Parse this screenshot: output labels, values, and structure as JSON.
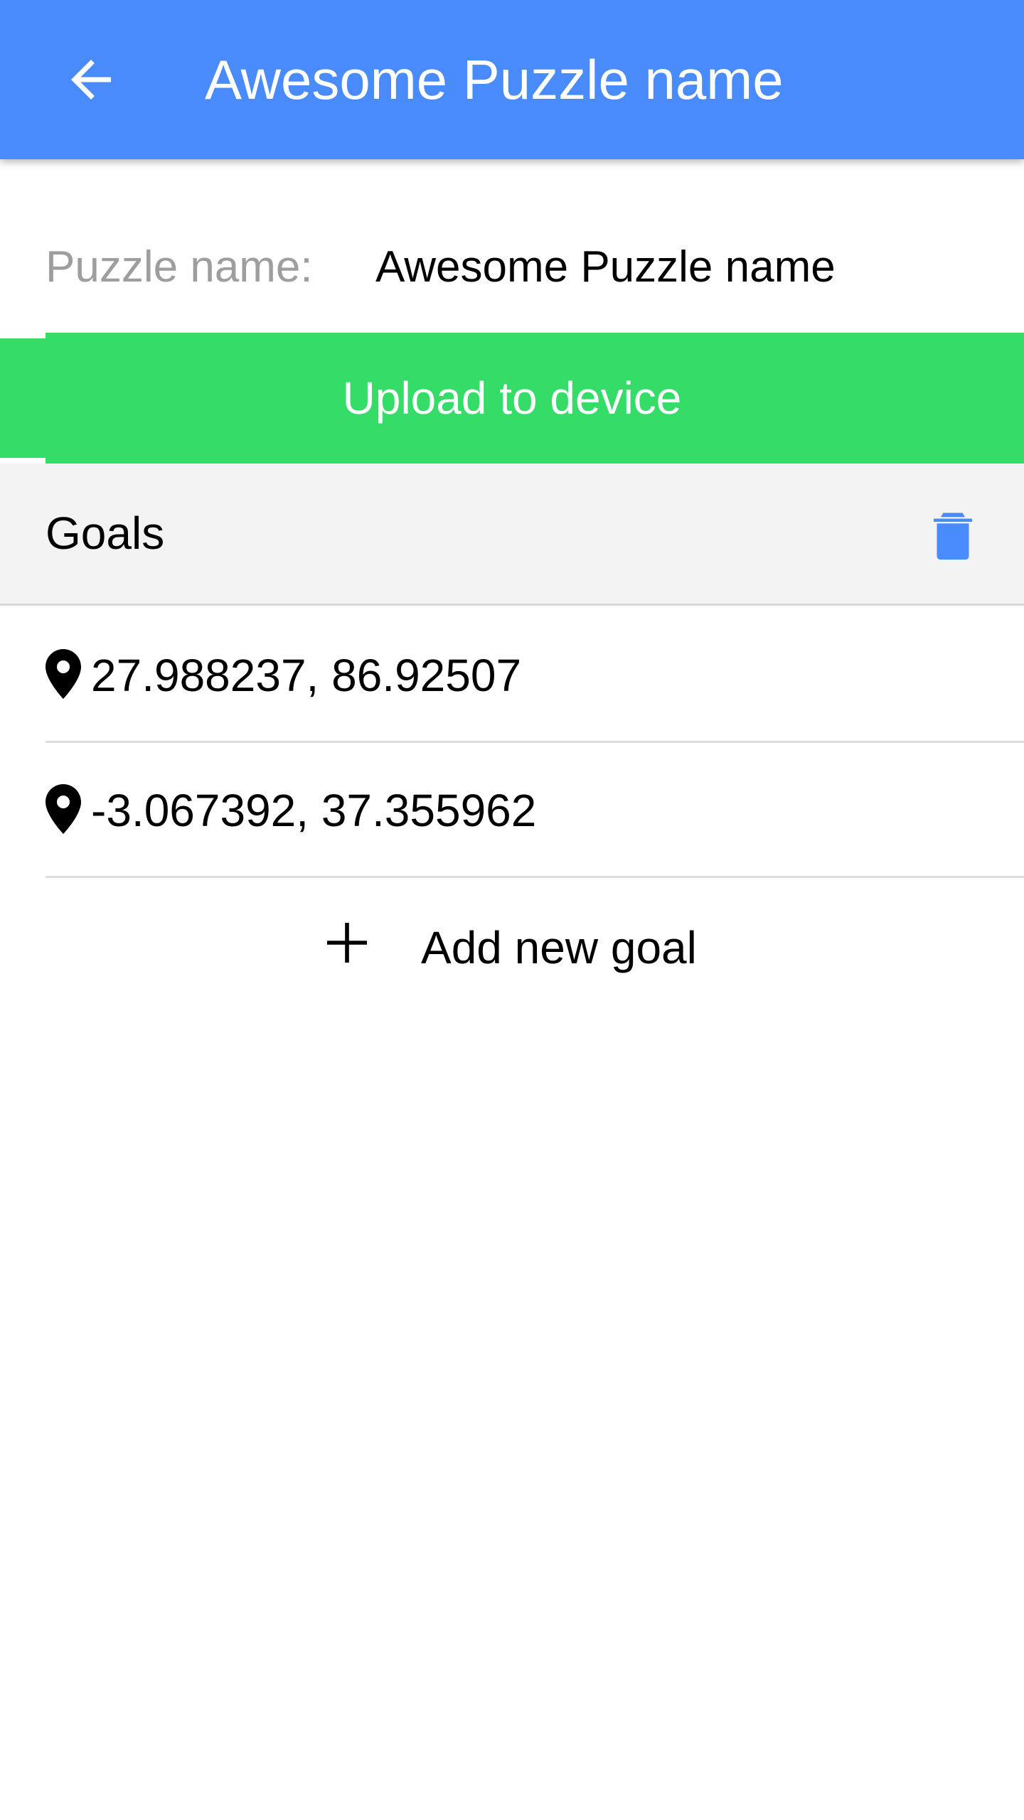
{
  "app_bar": {
    "title": "Awesome Puzzle name",
    "back_icon": "arrow-back-icon",
    "background": "#4a8bfc"
  },
  "puzzle_name": {
    "label": "Puzzle name:",
    "value": "Awesome Puzzle name",
    "placeholder": ""
  },
  "upload": {
    "label": "Upload to device",
    "color": "#35dc68"
  },
  "goals": {
    "title": "Goals",
    "delete_icon": "trash-icon",
    "items": [
      {
        "icon": "location-pin-icon",
        "coords": "27.988237, 86.92507"
      },
      {
        "icon": "location-pin-icon",
        "coords": "-3.067392, 37.355962"
      }
    ],
    "add_icon": "plus-icon",
    "add_label": "Add new goal"
  }
}
